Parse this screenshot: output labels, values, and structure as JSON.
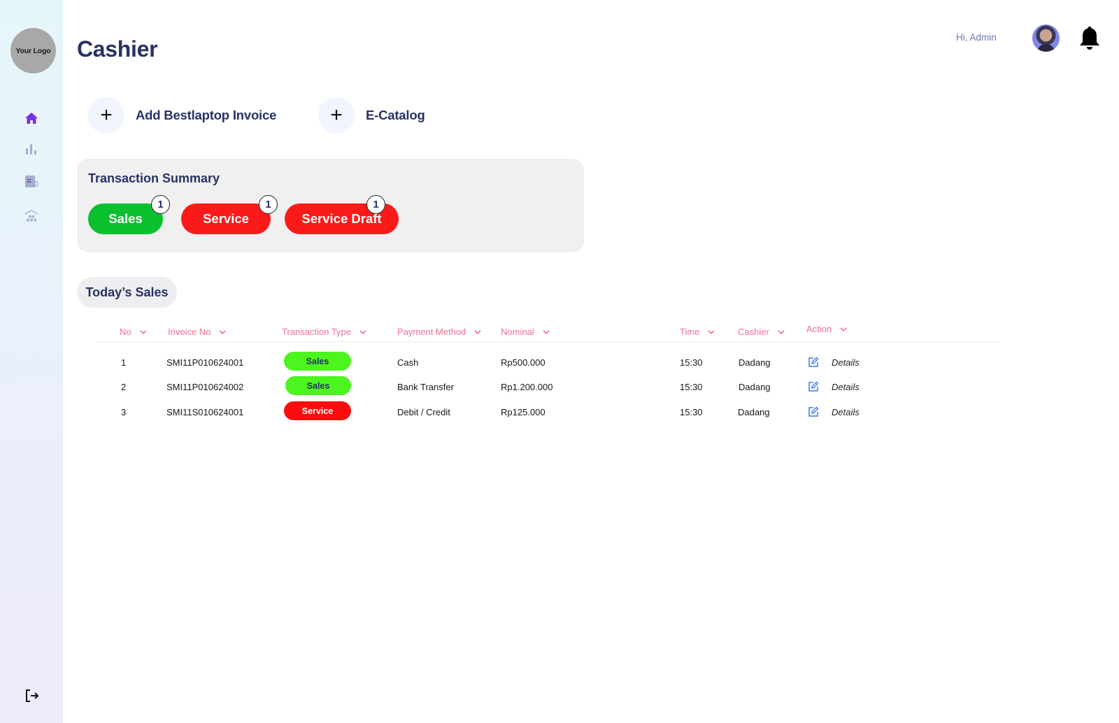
{
  "sidebar": {
    "logo_text": "Your Logo",
    "nav_items": [
      {
        "icon": "home-icon",
        "active": true
      },
      {
        "icon": "bar-chart-icon",
        "active": false
      },
      {
        "icon": "cash-register-icon",
        "active": false
      },
      {
        "icon": "warehouse-icon",
        "active": false
      }
    ],
    "logout_icon": "logout-icon"
  },
  "header": {
    "title": "Cashier",
    "greeting": "Hi, Admin",
    "notification_icon": "bell-icon"
  },
  "actions": [
    {
      "label": "Add Bestlaptop Invoice",
      "icon": "plus-icon"
    },
    {
      "label": "E-Catalog",
      "icon": "plus-icon"
    }
  ],
  "summary": {
    "title": "Transaction Summary",
    "pills": [
      {
        "label": "Sales",
        "count": "1",
        "color": "#0bc02f"
      },
      {
        "label": "Service",
        "count": "1",
        "color": "#fb1a1a"
      },
      {
        "label": "Service Draft",
        "count": "1",
        "color": "#fb1a1a"
      }
    ]
  },
  "today": {
    "title": "Today’s Sales",
    "columns": [
      "No",
      "Invoice No",
      "Transaction Type",
      "Payment Method",
      "Nominal",
      "Time",
      "Cashier",
      "Action"
    ],
    "rows": [
      {
        "no": "1",
        "invoice": "SMI11P010624001",
        "type": "Sales",
        "type_bg": "#4cf51d",
        "type_fg": "#283168",
        "payment": "Cash",
        "nominal": "Rp500.000",
        "time": "15:30",
        "cashier": "Dadang",
        "action": "Details"
      },
      {
        "no": "2",
        "invoice": "SMI11P010624002",
        "type": "Sales",
        "type_bg": "#4cf51d",
        "type_fg": "#283168",
        "payment": "Bank Transfer",
        "nominal": "Rp1.200.000",
        "time": "15:30",
        "cashier": "Dadang",
        "action": "Details"
      },
      {
        "no": "3",
        "invoice": "SMI11S010624001",
        "type": "Service",
        "type_bg": "#fb0d0d",
        "type_fg": "#ffffff",
        "payment": "Debit / Credit",
        "nominal": "Rp125.000",
        "time": "15:30",
        "cashier": "Dadang",
        "action": "Details"
      }
    ]
  },
  "colors": {
    "primary_text": "#283168",
    "header_pink": "#f06f92",
    "active_nav": "#7a2df0",
    "inactive_nav": "#a6acd6",
    "edit_icon": "#3a7bea"
  }
}
